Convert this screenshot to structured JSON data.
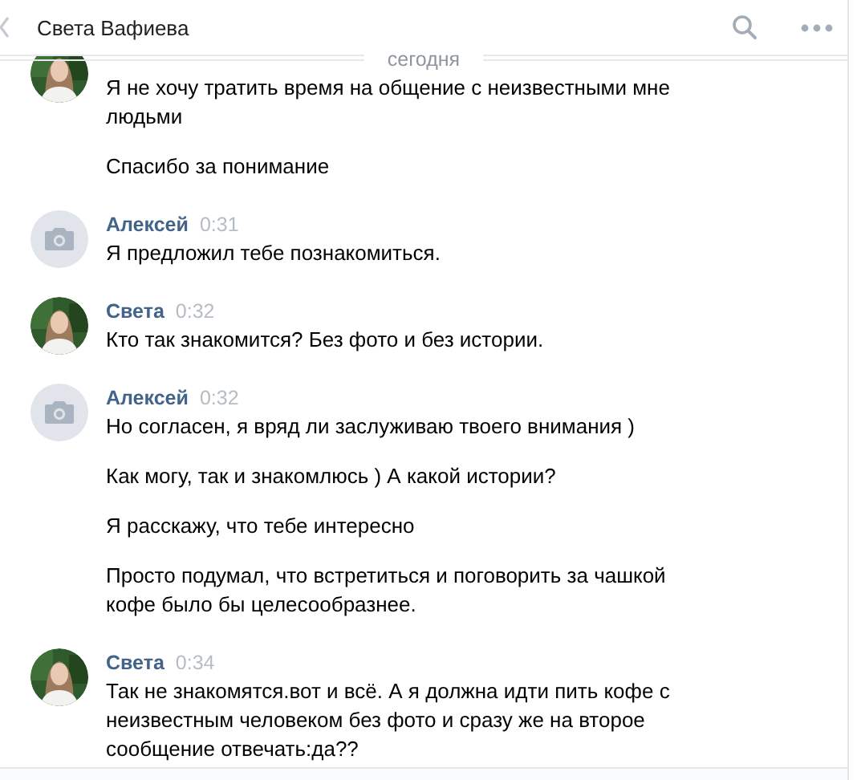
{
  "header": {
    "title": "Света Вафиева"
  },
  "date_separator": "сегодня",
  "messages": [
    {
      "paragraphs": [
        "Я не хочу тратить время на общение с неизвестными мне людьми",
        "Спасибо за понимание"
      ]
    },
    {
      "author": "Алексей",
      "time": "0:31",
      "kind": "camera",
      "paragraphs": [
        "Я предложил тебе познакомиться."
      ]
    },
    {
      "author": "Света",
      "time": "0:32",
      "paragraphs": [
        "Кто так знакомится? Без фото и без истории."
      ]
    },
    {
      "author": "Алексей",
      "time": "0:32",
      "kind": "camera",
      "paragraphs": [
        "Но согласен, я вряд ли заслуживаю твоего внимания )",
        "Как могу, так и знакомлюсь ) А какой истории?",
        "Я расскажу, что тебе интересно",
        "Просто подумал, что встретиться и поговорить за чашкой кофе было бы целесообразнее."
      ]
    },
    {
      "author": "Света",
      "time": "0:34",
      "paragraphs": [
        "Так не знакомятся.вот и всё. А я должна идти пить кофе с неизвестным человеком без фото и сразу же на второе сообщение отвечать:да??"
      ]
    }
  ]
}
